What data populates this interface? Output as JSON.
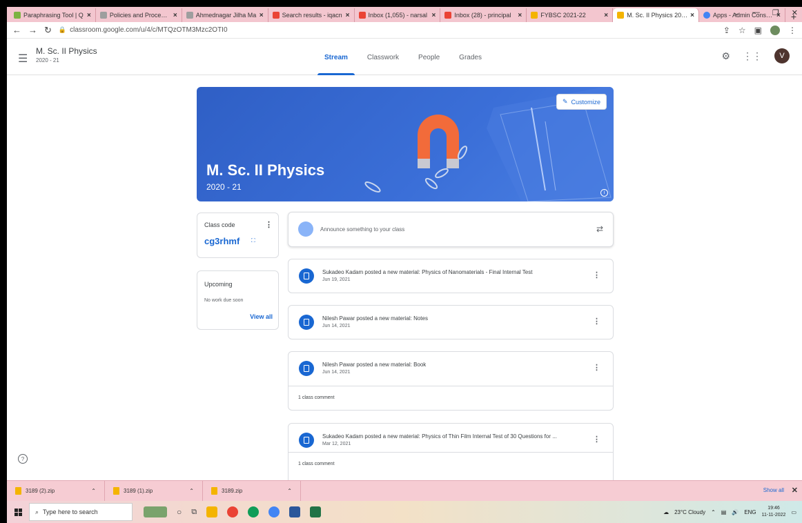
{
  "browser": {
    "tabs": [
      {
        "title": "Paraphrasing Tool | Q",
        "color": "#7cb342"
      },
      {
        "title": "Policies and Procedure",
        "color": "#9e9e9e"
      },
      {
        "title": "Ahmednagar Jilha Ma",
        "color": "#9e9e9e"
      },
      {
        "title": "Search results - iqacn",
        "color": "#ea4335"
      },
      {
        "title": "Inbox (1,055) - narsal",
        "color": "#ea4335"
      },
      {
        "title": "Inbox (28) - principal",
        "color": "#ea4335"
      },
      {
        "title": "FYBSC 2021-22",
        "color": "#f4b400"
      },
      {
        "title": "M. Sc. II Physics 2020",
        "color": "#f4b400",
        "active": true
      },
      {
        "title": "Apps - Admin Console",
        "color": "#4285f4"
      }
    ],
    "new_tab": "+",
    "url": "classroom.google.com/u/4/c/MTQzOTM3Mzc2OTI0"
  },
  "header": {
    "class_name": "M. Sc. II Physics",
    "class_year": "2020 - 21",
    "tabs": [
      "Stream",
      "Classwork",
      "People",
      "Grades"
    ],
    "active_tab": "Stream",
    "avatar_letter": "V"
  },
  "banner": {
    "title": "M. Sc. II Physics",
    "subtitle": "2020 - 21",
    "customize_label": "Customize"
  },
  "class_code": {
    "label": "Class code",
    "code": "cg3rhmf"
  },
  "upcoming": {
    "title": "Upcoming",
    "empty": "No work due soon",
    "view_all": "View all"
  },
  "announce": {
    "placeholder": "Announce something to your class"
  },
  "posts": [
    {
      "title": "Sukadeo Kadam posted a new material: Physics of Nanomaterials - Final Internal Test",
      "date": "Jun 19, 2021"
    },
    {
      "title": "Nilesh Pawar posted a new material: Notes",
      "date": "Jun 14, 2021"
    },
    {
      "title": "Nilesh Pawar posted a new material: Book",
      "date": "Jun 14, 2021",
      "comments": "1 class comment"
    },
    {
      "title": "Sukadeo Kadam posted a new material: Physics of Thin Film Internal Test of 30 Questions for ...",
      "date": "Mar 12, 2021",
      "comments": "1 class comment"
    }
  ],
  "downloads": {
    "files": [
      "3189 (2).zip",
      "3189 (1).zip",
      "3189.zip"
    ],
    "show_all": "Show all"
  },
  "taskbar": {
    "search_placeholder": "Type here to search",
    "weather": "23°C  Cloudy",
    "lang": "ENG",
    "time": "19:46",
    "date": "11-11-2022"
  },
  "colors": {
    "accent": "#1967d2",
    "banner": "#3b6fd8"
  }
}
